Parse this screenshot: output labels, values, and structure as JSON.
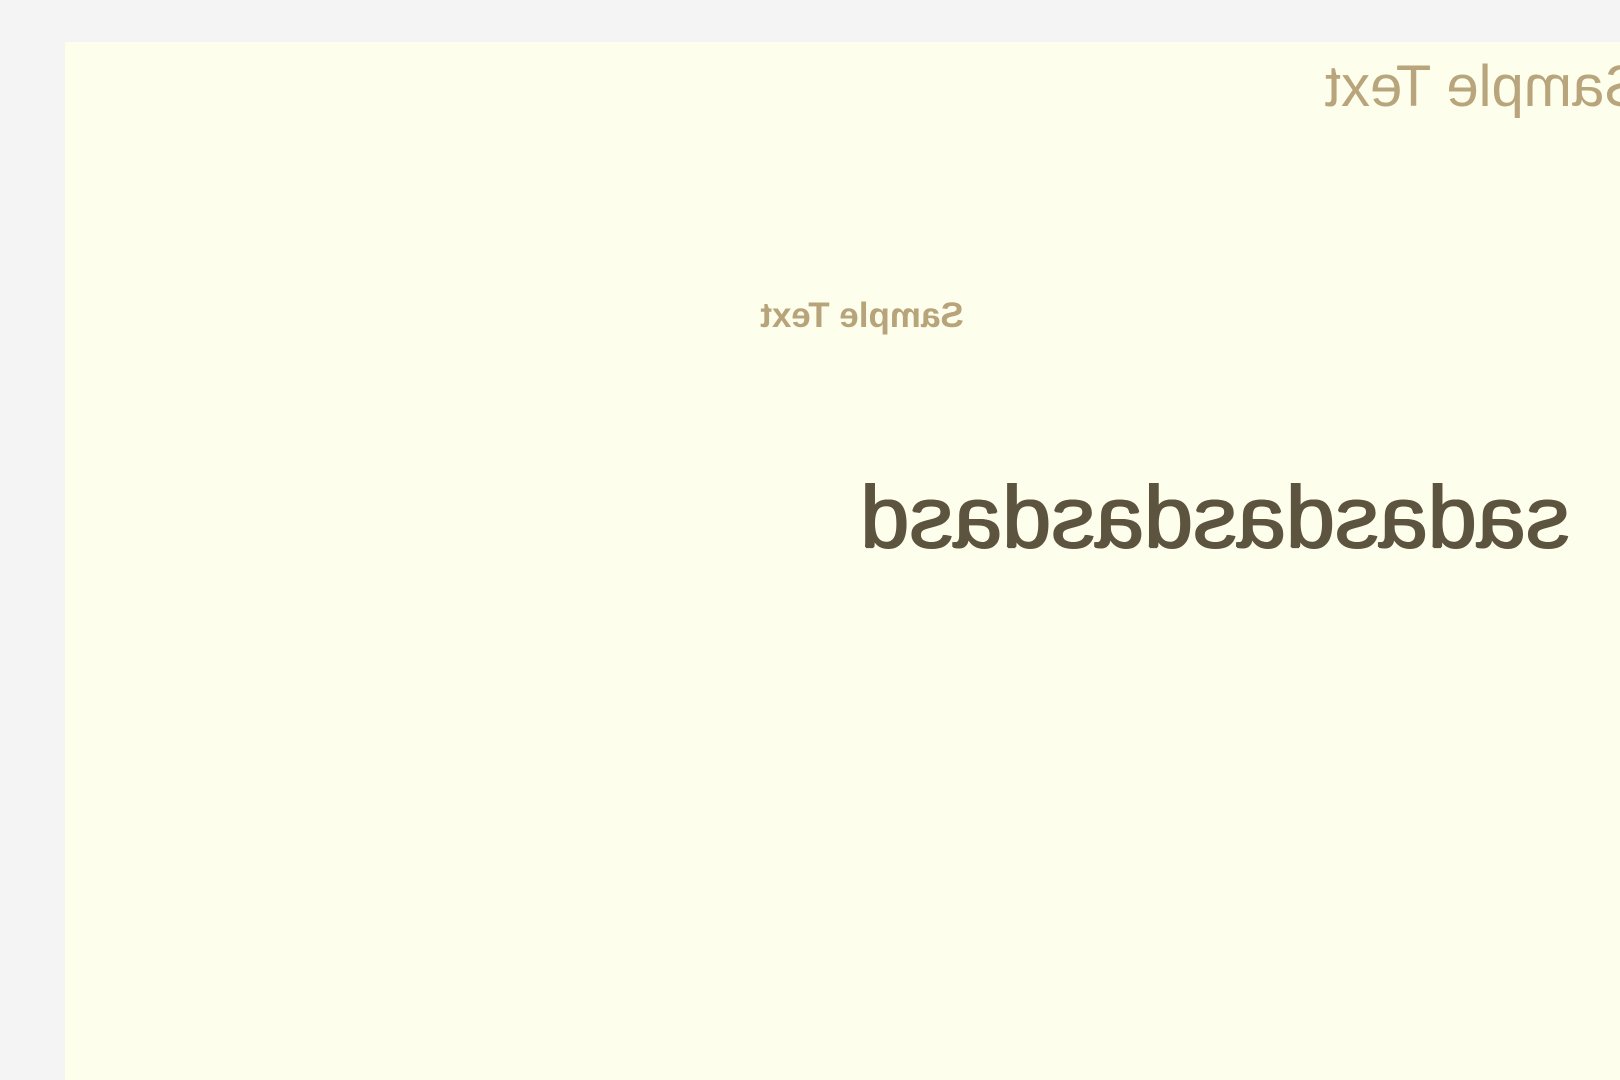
{
  "canvas": {
    "layers": [
      {
        "text": "Sample Text",
        "color": "#b8a57c"
      },
      {
        "text": "Sample Text",
        "color": "#b8a47a"
      },
      {
        "text": "sadasdasdasdasd",
        "color": "#5d543f"
      }
    ]
  },
  "colors": {
    "workspace_background": "#f4f4f4",
    "page_background": "#fefeed"
  }
}
